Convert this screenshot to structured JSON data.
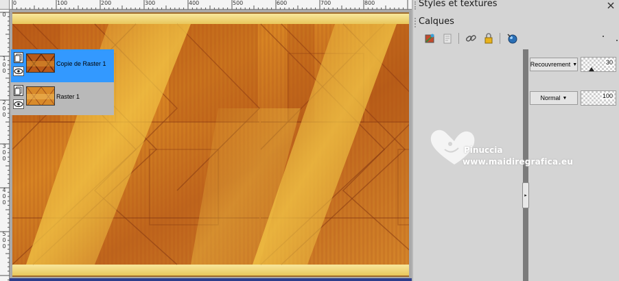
{
  "rulers": {
    "horizontal": [
      "0",
      "100",
      "200",
      "300",
      "400",
      "500",
      "600",
      "700",
      "800"
    ],
    "vertical": [
      {
        "digits": [
          "0"
        ]
      },
      {
        "digits": [
          "1",
          "0",
          "0"
        ]
      },
      {
        "digits": [
          "2",
          "0",
          "0"
        ]
      },
      {
        "digits": [
          "3",
          "0",
          "0"
        ]
      },
      {
        "digits": [
          "4",
          "0",
          "0"
        ]
      },
      {
        "digits": [
          "5",
          "0",
          "0"
        ]
      }
    ]
  },
  "panels": {
    "styles_title": "Styles et textures",
    "layers_title": "Calques"
  },
  "toolbar_icons": [
    "new-layer-icon",
    "layer-properties-icon",
    "link-icon",
    "lock-icon",
    "mask-icon"
  ],
  "layers": [
    {
      "name": "Copie de Raster 1",
      "blend_mode": "Recouvrement",
      "opacity": "30",
      "opacity_fraction": 0.3,
      "selected": true
    },
    {
      "name": "Raster 1",
      "blend_mode": "Normal",
      "opacity": "100",
      "opacity_fraction": 1.0,
      "selected": false
    }
  ],
  "watermark": {
    "name": "Pinuccia",
    "url": "www.maidiregrafica.eu"
  },
  "colors": {
    "selected_layer": "#3399ff",
    "layer_row": "#b9b9b9",
    "canvas_orange": "#d87a1c",
    "canvas_yellow": "#f2d574",
    "scrollbar_blue": "#2c3e8c"
  }
}
